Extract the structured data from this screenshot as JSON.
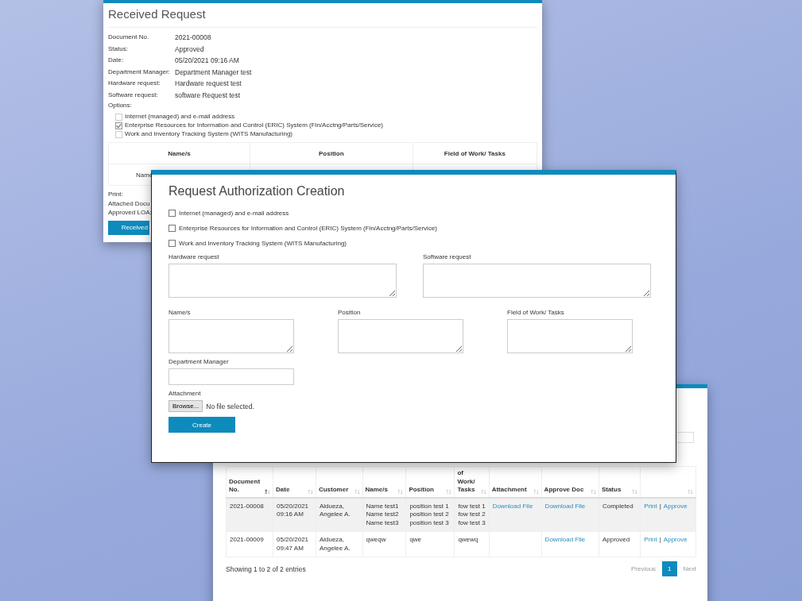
{
  "received_request": {
    "title": "Received Request",
    "fields": [
      {
        "label": "Document No.",
        "value": "2021-00008"
      },
      {
        "label": "Status:",
        "value": "Approved"
      },
      {
        "label": "Date:",
        "value": "05/20/2021 09:16 AM"
      },
      {
        "label": "Department Manager:",
        "value": "Department Manager test"
      },
      {
        "label": "Hardware request:",
        "value": "Hardware request test"
      },
      {
        "label": "Software request:",
        "value": "software Request test"
      }
    ],
    "options_label": "Options:",
    "options": [
      {
        "label": "Internet (managed) and e-mail address",
        "checked": false
      },
      {
        "label": "Enterprise Resources for Information and Control (ERIC) System (Fin/Acctng/Parts/Service)",
        "checked": true
      },
      {
        "label": "Work and Inventory Tracking System (WITS Manufacturing)",
        "checked": false
      }
    ],
    "table": {
      "columns": [
        "Name/s",
        "Position",
        "Field of Work/ Tasks"
      ],
      "rows": [
        [
          "Name"
        ]
      ]
    },
    "footer_lines": [
      "Print:",
      "Attached Docu",
      "Approved LOA:"
    ],
    "button": "Received"
  },
  "request_form": {
    "title": "Request Authorization Creation",
    "options": [
      {
        "label": "Internet (managed) and e-mail address",
        "checked": false
      },
      {
        "label": "Enterprise Resources for Information and Control (ERIC) System (Fin/Acctng/Parts/Service)",
        "checked": false
      },
      {
        "label": "Work and Inventory Tracking System (WITS Manufacturing)",
        "checked": false
      }
    ],
    "wide_fields": [
      {
        "label": "Hardware request"
      },
      {
        "label": "Software request"
      }
    ],
    "narrow_fields": [
      {
        "label": "Name/s"
      },
      {
        "label": "Position"
      },
      {
        "label": "Field of Work/ Tasks"
      }
    ],
    "manager_label": "Department Manager",
    "attachment_label": "Attachment",
    "browse_button": "Browse...",
    "file_status": "No file selected.",
    "submit_button": "Create"
  },
  "request_list": {
    "columns": [
      {
        "label": "Document No.",
        "sorted": true
      },
      {
        "label": "Date",
        "sorted": false
      },
      {
        "label": "Customer",
        "sorted": false
      },
      {
        "label": "Name/s",
        "sorted": false
      },
      {
        "label": "Position",
        "sorted": false
      },
      {
        "label": "of Work/ Tasks",
        "sorted": false
      },
      {
        "label": "Attachment",
        "sorted": false
      },
      {
        "label": "Approve Doc",
        "sorted": false
      },
      {
        "label": "Status",
        "sorted": false
      },
      {
        "sorted": false
      }
    ],
    "rows": [
      {
        "document_no": "2021-00008",
        "date": "05/20/2021\n09:16 AM",
        "customer": "Aldueza,\nAngelee A.",
        "names": "Name test1\nName test2\nName test3",
        "position": "position test 1 position test 2 position test 3",
        "field_of_work": "fow test 1\nfow test 2\nfow test 3",
        "attachment": "Download File",
        "approve_doc": "Download File",
        "status": "Completed",
        "actions": [
          "Print",
          "Approve"
        ]
      },
      {
        "document_no": "2021-00009",
        "date": "05/20/2021\n09:47 AM",
        "customer": "Aldueza,\nAngelee A.",
        "names": "qweqw",
        "position": "qwe",
        "field_of_work": "qwewq",
        "approve_doc": "Download File",
        "status": "Approved",
        "actions": [
          "Print",
          "Approve"
        ]
      }
    ],
    "action_separator": "|",
    "summary": "Showing 1 to 2 of 2 entries",
    "pagination": {
      "previous": {
        "label": "Previous",
        "disabled": true
      },
      "pages": [
        {
          "label": "1",
          "selected": true
        }
      ],
      "next": {
        "label": "Next",
        "disabled": true
      }
    }
  }
}
